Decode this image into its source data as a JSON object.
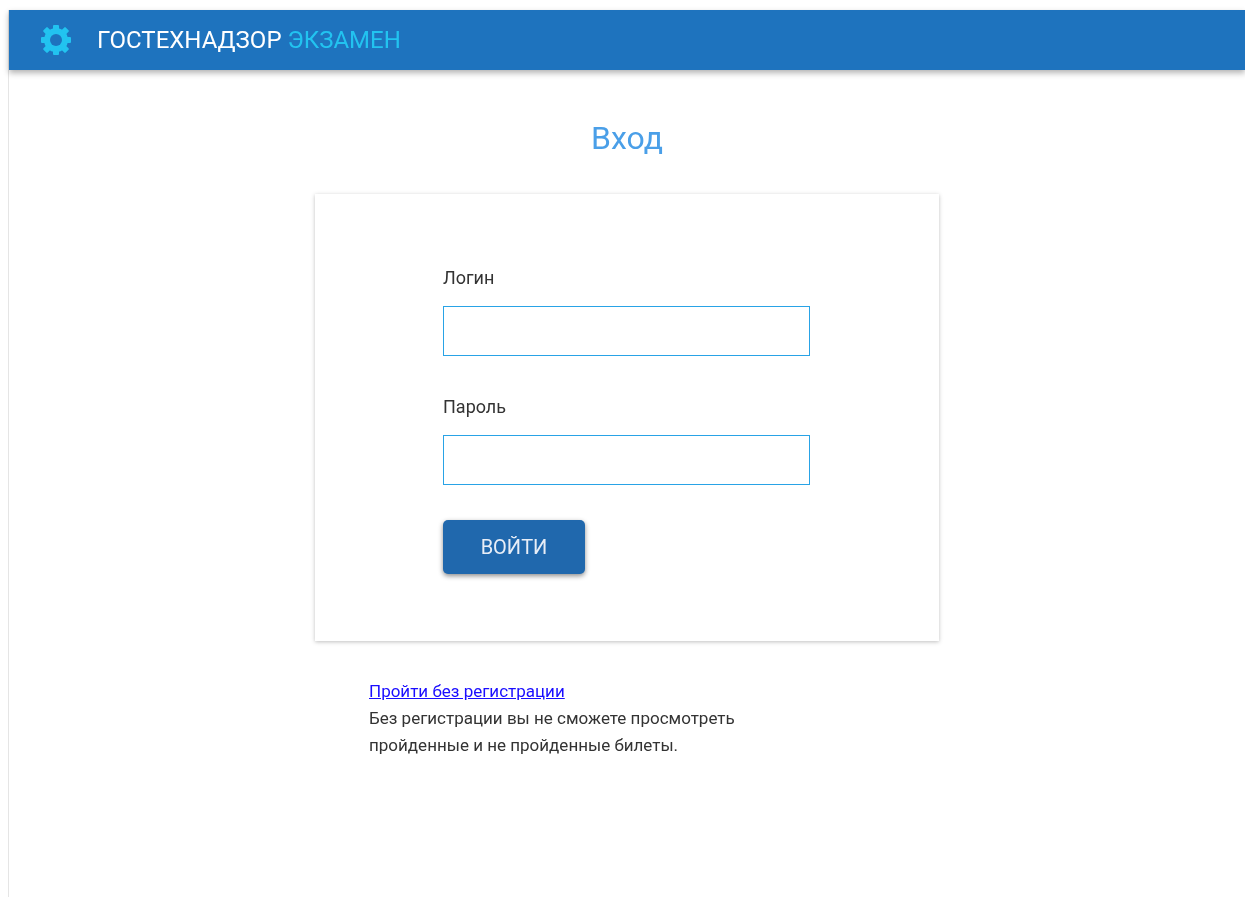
{
  "header": {
    "brand": "ГОСТЕХНАДЗОР",
    "brand_accent": "ЭКЗАМЕН"
  },
  "title": "Вход",
  "form": {
    "fields": [
      {
        "label": "Логин"
      },
      {
        "label": "Пароль"
      }
    ],
    "submit": "ВОЙТИ"
  },
  "guest_link": "Пройти без регистрации",
  "guest_note": "Без регистрации вы не сможете просмотреть пройденные и не пройденные билеты."
}
